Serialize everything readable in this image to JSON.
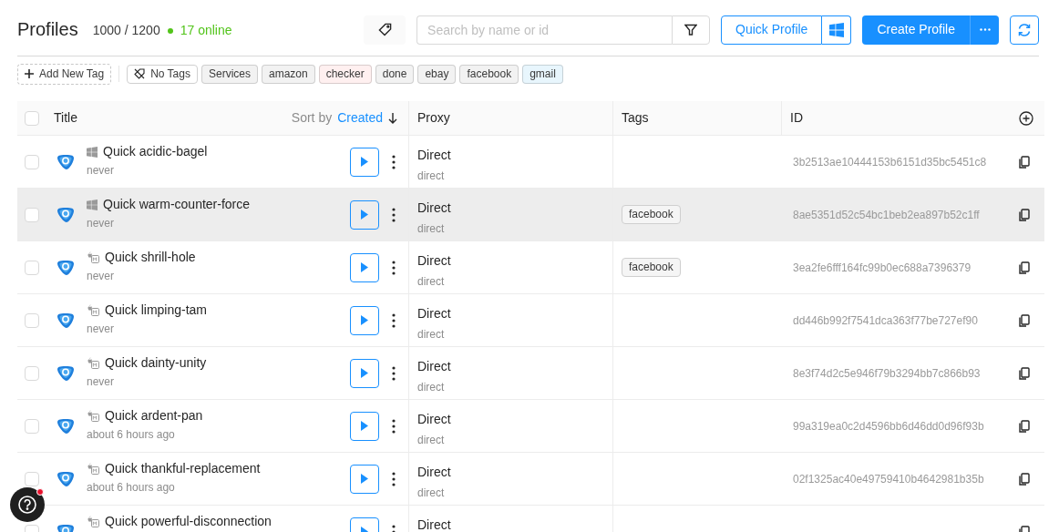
{
  "header": {
    "title": "Profiles",
    "count": "1000 / 1200",
    "online": "17 online",
    "search": {
      "placeholder": "Search by name or id"
    },
    "quick_profile": "Quick Profile",
    "create_profile": "Create Profile"
  },
  "tag_bar": {
    "add_tag": "Add New Tag",
    "no_tags": "No Tags",
    "tags": [
      {
        "label": "Services",
        "color": "#f2f2f2"
      },
      {
        "label": "amazon",
        "color": "#f2f2f2"
      },
      {
        "label": "checker",
        "color": "#fff0f0"
      },
      {
        "label": "done",
        "color": "#f2f2f2"
      },
      {
        "label": "ebay",
        "color": "#f2f2f2"
      },
      {
        "label": "facebook",
        "color": "#f2f2f2"
      },
      {
        "label": "gmail",
        "color": "#e8f6fd"
      }
    ]
  },
  "table": {
    "select_all": {
      "checked": false
    },
    "columns": [
      "Title",
      "Proxy",
      "Tags",
      "ID"
    ],
    "sort": {
      "label": "Sort by",
      "field": "Created"
    },
    "rows": [
      {
        "kind": "windows",
        "title": "Quick acidic-bagel",
        "last_run": "never",
        "proxy": "Direct",
        "proxy_type": "direct",
        "tags": [],
        "id": "3b2513ae10444153b6151d35bc5451c8",
        "selected": false,
        "hovered": false
      },
      {
        "kind": "windows",
        "title": "Quick warm-counter-force",
        "last_run": "never",
        "proxy": "Direct",
        "proxy_type": "direct",
        "tags": [
          "facebook"
        ],
        "id": "8ae5351d52c54bc1beb2ea897b52c1ff",
        "selected": false,
        "hovered": true
      },
      {
        "kind": "mac",
        "title": "Quick shrill-hole",
        "last_run": "never",
        "proxy": "Direct",
        "proxy_type": "direct",
        "tags": [
          "facebook"
        ],
        "id": "3ea2fe6fff164fc99b0ec688a7396379",
        "selected": false,
        "hovered": false
      },
      {
        "kind": "mac",
        "title": "Quick limping-tam",
        "last_run": "never",
        "proxy": "Direct",
        "proxy_type": "direct",
        "tags": [],
        "id": "dd446b992f7541dca363f77be727ef90",
        "selected": false,
        "hovered": false
      },
      {
        "kind": "mac",
        "title": "Quick dainty-unity",
        "last_run": "never",
        "proxy": "Direct",
        "proxy_type": "direct",
        "tags": [],
        "id": "8e3f74d2c5e946f79b3294bb7c866b93",
        "selected": false,
        "hovered": false
      },
      {
        "kind": "mac",
        "title": "Quick ardent-pan",
        "last_run": "about 6 hours ago",
        "proxy": "Direct",
        "proxy_type": "direct",
        "tags": [],
        "id": "99a319ea0c2d4596bb6d46dd0d96f93b",
        "selected": false,
        "hovered": false
      },
      {
        "kind": "mac",
        "title": "Quick thankful-replacement",
        "last_run": "about 6 hours ago",
        "proxy": "Direct",
        "proxy_type": "direct",
        "tags": [],
        "id": "02f1325ac40e49759410b4642981b35b",
        "selected": false,
        "hovered": false
      },
      {
        "kind": "mac",
        "title": "Quick powerful-disconnection",
        "proxy": "Direct",
        "tags": [],
        "selected": false,
        "hovered": false
      }
    ]
  }
}
